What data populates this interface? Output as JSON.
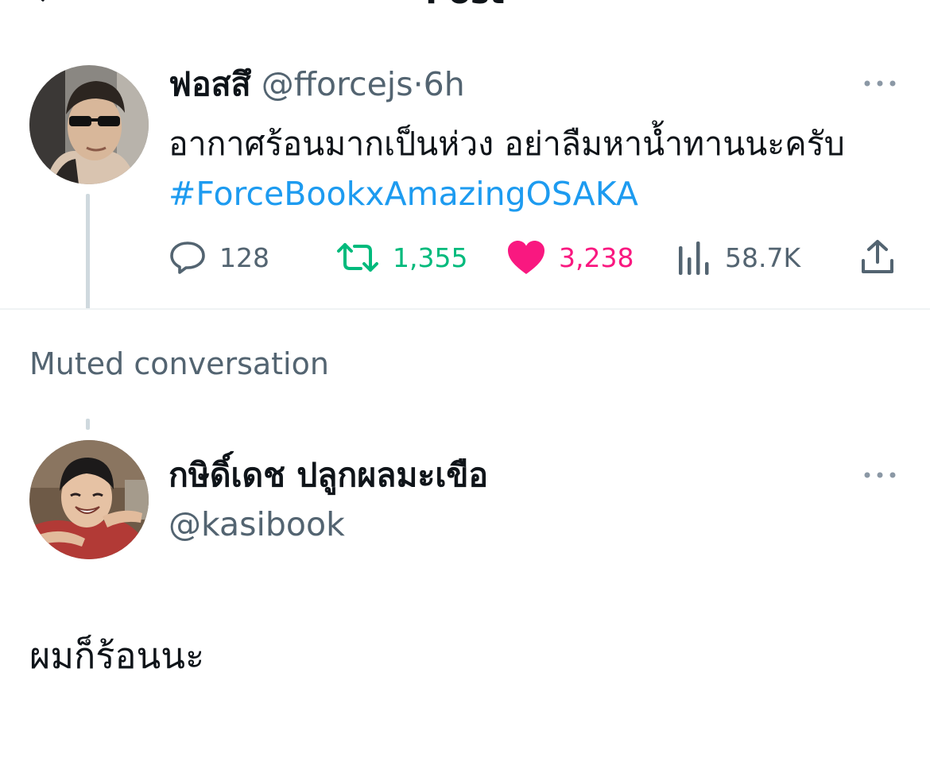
{
  "header": {
    "title": "Post"
  },
  "parent_tweet": {
    "display_name": "ฟอสสึ",
    "handle": "@fforcejs",
    "separator": "·",
    "time": "6h",
    "text": "อากาศร้อนมากเป็นห่วง อย่าลืมหาน้ำทานนะครับ",
    "hashtag": "#ForceBookxAmazingOSAKA",
    "stats": {
      "replies": "128",
      "reposts": "1,355",
      "likes": "3,238",
      "views": "58.7K"
    },
    "liked": true,
    "more_icon": "more-horizontal-icon"
  },
  "muted_label": "Muted conversation",
  "reply_tweet": {
    "display_name": "กษิดิ์เดช ปลูกผลมะเขือ",
    "handle": "@kasibook",
    "text": "ผมก็ร้อนนะ",
    "more_icon": "more-horizontal-icon"
  },
  "colors": {
    "text_primary": "#0f1419",
    "text_secondary": "#536471",
    "link": "#1d9bf0",
    "repost_green": "#00ba7c",
    "like_pink": "#f91880",
    "thread_line": "#cfd9de",
    "divider": "#eff3f4"
  }
}
